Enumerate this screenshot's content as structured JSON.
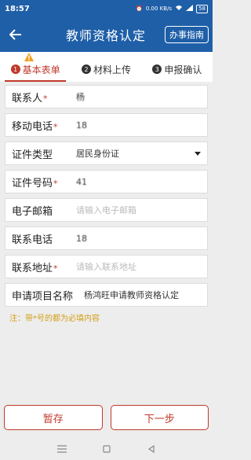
{
  "status": {
    "time": "18:57",
    "battery": "58",
    "net": "0.00 KB/s"
  },
  "app_bar": {
    "title": "教师资格认定",
    "guide_label": "办事指南"
  },
  "steps": [
    {
      "num": "1",
      "label": "基本表单"
    },
    {
      "num": "2",
      "label": "材料上传"
    },
    {
      "num": "3",
      "label": "申报确认"
    }
  ],
  "form": {
    "contact": {
      "label": "联系人",
      "value": "杨"
    },
    "mobile": {
      "label": "移动电话",
      "value": "18"
    },
    "id_type": {
      "label": "证件类型",
      "value": "居民身份证"
    },
    "id_number": {
      "label": "证件号码",
      "value": "41"
    },
    "email": {
      "label": "电子邮箱",
      "placeholder": "请输入电子邮箱"
    },
    "phone": {
      "label": "联系电话",
      "value": "18"
    },
    "address": {
      "label": "联系地址",
      "placeholder": "请输入联系地址"
    },
    "project": {
      "label": "申请项目名称",
      "value": "杨鸿旺申请教师资格认定"
    }
  },
  "note": "注：带*号的都为必填内容",
  "buttons": {
    "save": "暂存",
    "next": "下一步"
  },
  "colors": {
    "primary": "#1f5fa8",
    "accent": "#c0392b",
    "note": "#d4a017"
  }
}
